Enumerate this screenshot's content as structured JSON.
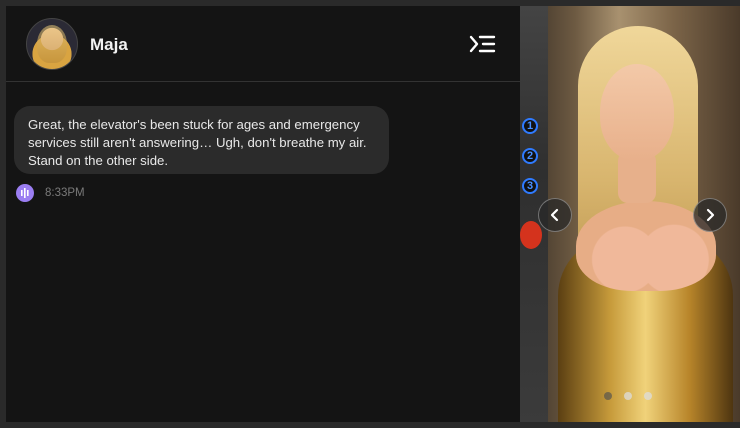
{
  "header": {
    "contact_name": "Maja"
  },
  "messages": [
    {
      "text": "Great, the elevator's been stuck for ages and emergency services still aren't answering… Ugh, don't breathe my air. Stand on the other side.",
      "time": "8:33PM",
      "audio_icon": "audio-wave-icon"
    }
  ],
  "gallery": {
    "elevator_buttons": [
      "1",
      "2",
      "3"
    ],
    "dot_count": 3,
    "active_dot_index": 0
  },
  "colors": {
    "background": "#141414",
    "bubble": "#2b2b2b",
    "accent_purple": "#9b7ef2",
    "text_light": "#e8e8e8",
    "timestamp": "#7a7a7a"
  },
  "icons": {
    "menu": "menu-collapse-icon",
    "prev": "chevron-left-icon",
    "next": "chevron-right-icon"
  }
}
